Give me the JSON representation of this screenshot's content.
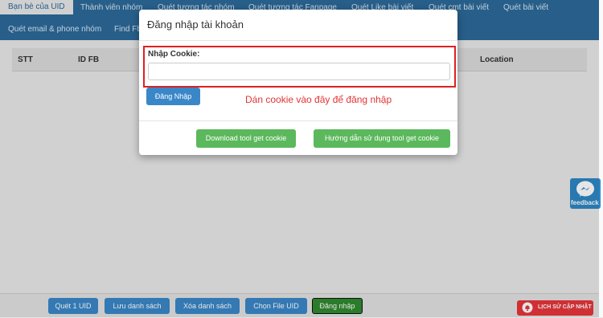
{
  "nav": {
    "tabs_row1": [
      "Bạn bè của UID",
      "Thành viên nhóm",
      "Quét tương tác nhóm",
      "Quét tương tác Fanpage",
      "Quét Like bài viết",
      "Quét cmt bài viết",
      "Quét bài viết"
    ],
    "tabs_row2": [
      "Quét email & phone nhóm",
      "Find Fb"
    ]
  },
  "table": {
    "headers": [
      "STT",
      "ID FB",
      "Location"
    ]
  },
  "modal": {
    "title": "Đăng nhập tài khoản",
    "cookie_label": "Nhập Cookie:",
    "cookie_value": "",
    "cookie_placeholder": "",
    "login_button": "Đăng Nhập",
    "hint": "Dán cookie vào đây để đăng nhập",
    "download_button": "Download tool get cookie",
    "guide_button": "Hướng dẫn sử dụng tool get cookie"
  },
  "bottom": {
    "buttons": [
      "Quét 1 UID",
      "Lưu danh sách",
      "Xóa danh sách",
      "Chọn File UID",
      "Đăng nhập"
    ]
  },
  "widgets": {
    "feedback_label": "feedback",
    "history_label": "LỊCH SỬ CẬP NHẬT"
  },
  "colors": {
    "nav_bg": "#2c6a9a",
    "primary": "#3a87c8",
    "success": "#5cb85c",
    "danger": "#e8353a"
  }
}
